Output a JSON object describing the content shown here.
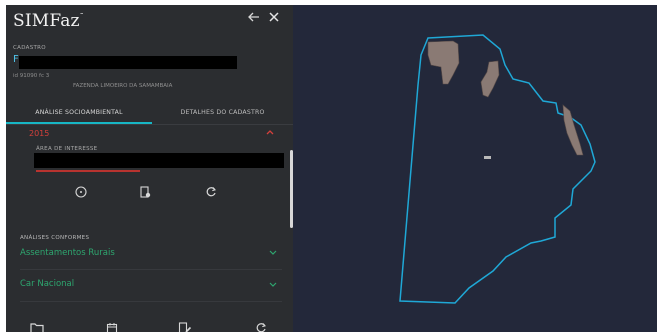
{
  "app": {
    "logo": "SIMFaz"
  },
  "header": {
    "back_icon": "arrow-left-icon",
    "close_icon": "close-icon"
  },
  "cadastro": {
    "label": "CADASTRO",
    "code_prefix": "F",
    "id_text": "id 91090 fc 3",
    "farm_name": "FAZENDA LIMOEIRO DA SAMAMBAIA"
  },
  "tabs": [
    {
      "label": "ANÁLISE SOCIOAMBIENTAL",
      "active": true
    },
    {
      "label": "DETALHES DO CADASTRO",
      "active": false
    }
  ],
  "analysis": {
    "year": "2015",
    "area_label": "ÁREA DE INTERESSE",
    "actions": [
      {
        "name": "info-icon",
        "glyph": "ⓘ"
      },
      {
        "name": "document-add-icon",
        "glyph": "▤"
      },
      {
        "name": "refresh-icon",
        "glyph": "↻"
      }
    ]
  },
  "conformes": {
    "heading": "ANÁLISES CONFORMES",
    "items": [
      {
        "label": "Assentamentos Rurais"
      },
      {
        "label": "Car Nacional"
      }
    ]
  },
  "bottom_toolbar": [
    {
      "name": "folder-icon",
      "glyph": "🗀"
    },
    {
      "name": "calendar-icon",
      "glyph": "▦"
    },
    {
      "name": "document-edit-icon",
      "glyph": "▤"
    },
    {
      "name": "refresh-icon",
      "glyph": "↻"
    }
  ],
  "colors": {
    "sidebar_bg": "#2b2d30",
    "map_bg": "#23283a",
    "accent_teal": "#17b6c4",
    "accent_green": "#2fbf86",
    "alert_red": "#d4403b",
    "polygon_outline": "#1fa8d6",
    "parcel_fill": "#8a7a74"
  }
}
